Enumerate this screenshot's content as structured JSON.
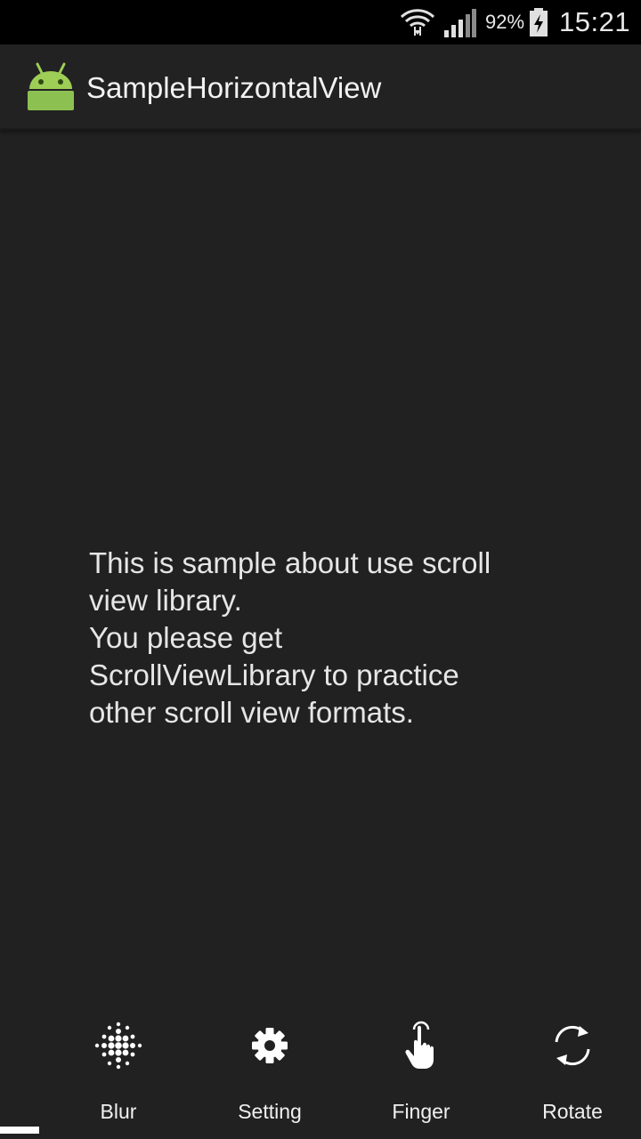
{
  "status_bar": {
    "battery_percent": "92%",
    "time": "15:21",
    "icons": [
      "wifi-icon",
      "signal-icon",
      "battery-charging-icon"
    ]
  },
  "action_bar": {
    "title": "SampleHorizontalView",
    "icon": "android-icon"
  },
  "content": {
    "lines": [
      "This is sample about use scroll",
      "view library.",
      "You please get",
      "ScrollViewLibrary to practice",
      "other scroll view formats."
    ]
  },
  "bottom_menu": {
    "items": [
      {
        "label": "Blur",
        "icon": "blur-icon"
      },
      {
        "label": "Setting",
        "icon": "gear-icon"
      },
      {
        "label": "Finger",
        "icon": "finger-icon"
      },
      {
        "label": "Rotate",
        "icon": "rotate-icon"
      }
    ]
  },
  "colors": {
    "background": "#212121",
    "status_bar": "#000000",
    "android_green": "#9fce57",
    "text": "#e6e6e6"
  }
}
